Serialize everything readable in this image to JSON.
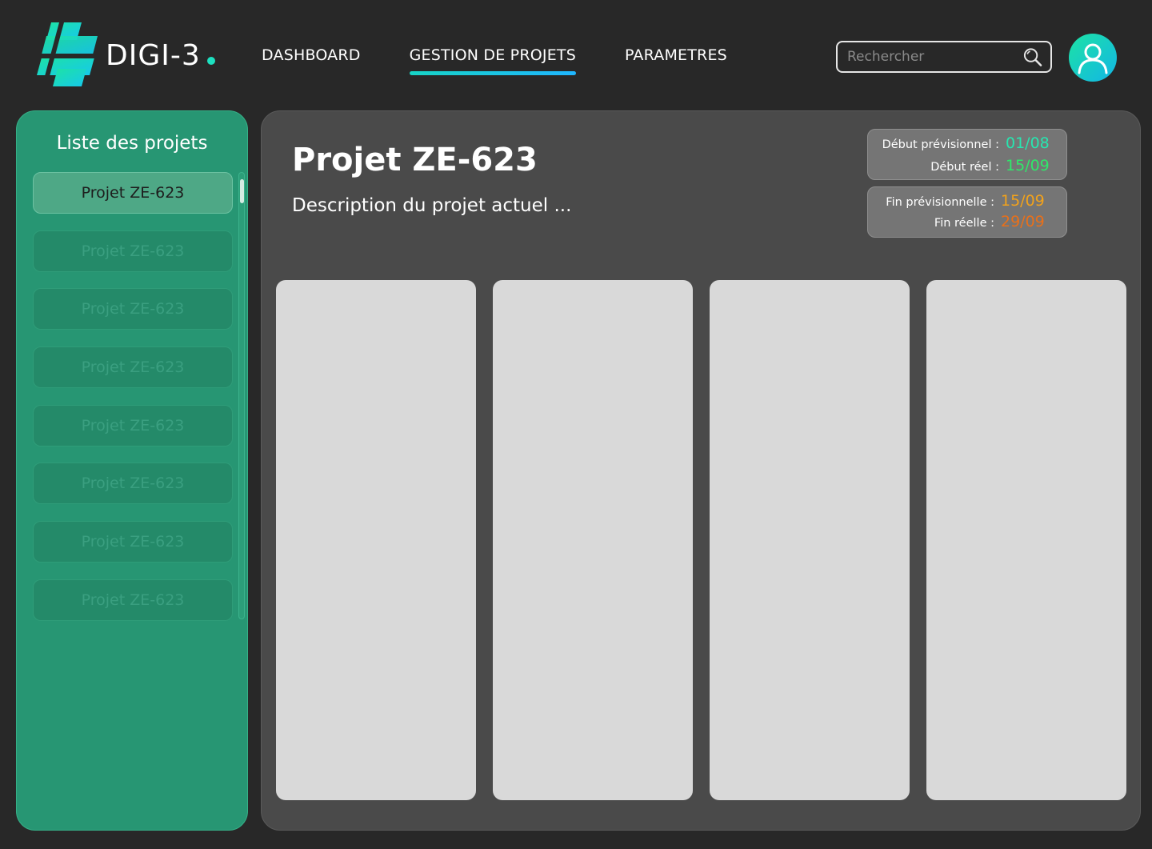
{
  "brand": {
    "name": "DIGI-3"
  },
  "nav": {
    "items": [
      {
        "label": "DASHBOARD"
      },
      {
        "label": "GESTION DE PROJETS"
      },
      {
        "label": "PARAMETRES"
      }
    ],
    "active": "GESTION DE PROJETS"
  },
  "search": {
    "placeholder": "Rechercher",
    "icon": "search-icon"
  },
  "user": {
    "icon": "user-icon"
  },
  "sidebar": {
    "title": "Liste des projets",
    "items": [
      {
        "label": "Projet ZE-623"
      },
      {
        "label": "Projet ZE-623"
      },
      {
        "label": "Projet ZE-623"
      },
      {
        "label": "Projet ZE-623"
      },
      {
        "label": "Projet ZE-623"
      },
      {
        "label": "Projet ZE-623"
      },
      {
        "label": "Projet ZE-623"
      },
      {
        "label": "Projet ZE-623"
      }
    ]
  },
  "project": {
    "title": "Projet ZE-623",
    "description": "Description du projet actuel ...",
    "dates": {
      "start_planned_label": "Début prévisionnel :",
      "start_planned": "01/08",
      "start_actual_label": "Début réel :",
      "start_actual": "15/09",
      "end_planned_label": "Fin prévisionnelle :",
      "end_planned": "15/09",
      "end_actual_label": "Fin réelle :",
      "end_actual": "29/09"
    }
  },
  "colors": {
    "accent": "#1de0c0",
    "sidebar": "#279673",
    "start_planned": "#27e6b0",
    "start_actual": "#2fe86a",
    "end_planned": "#f2a21b",
    "end_actual": "#e8701a"
  }
}
